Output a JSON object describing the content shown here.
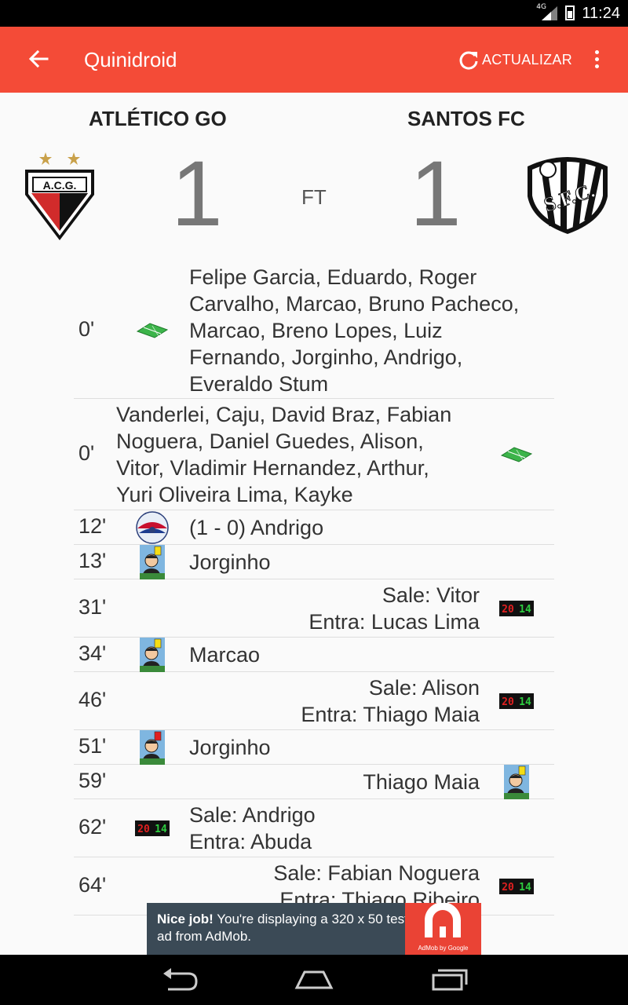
{
  "status_bar": {
    "time": "11:24",
    "network": "4G"
  },
  "app_bar": {
    "title": "Quinidroid",
    "refresh_label": "ACTUALIZAR"
  },
  "match": {
    "home": {
      "name": "ATLÉTICO GO",
      "score": "1",
      "crest_text": "A.C.G."
    },
    "away": {
      "name": "SANTOS FC",
      "score": "1",
      "crest_text": "S.F.C."
    },
    "status": "FT"
  },
  "events": [
    {
      "minute": "0'",
      "side": "home",
      "type": "lineup",
      "lines": [
        "Felipe Garcia, Eduardo, Roger",
        "Carvalho, Marcao, Bruno Pacheco,",
        "Marcao, Breno Lopes, Luiz",
        "Fernando, Jorginho, Andrigo,",
        "Everaldo Stum"
      ]
    },
    {
      "minute": "0'",
      "side": "away",
      "type": "lineup",
      "lines": [
        "Vanderlei, Caju, David Braz, Fabian",
        "Noguera, Daniel Guedes, Alison,",
        "Vitor, Vladimir Hernandez, Arthur,",
        "Yuri Oliveira Lima, Kayke"
      ]
    },
    {
      "minute": "12'",
      "side": "home",
      "type": "goal",
      "lines": [
        "(1 - 0) Andrigo"
      ]
    },
    {
      "minute": "13'",
      "side": "home",
      "type": "yellow-card",
      "lines": [
        "Jorginho"
      ]
    },
    {
      "minute": "31'",
      "side": "away",
      "type": "substitution",
      "lines": [
        "Sale: Vitor",
        "Entra: Lucas Lima"
      ]
    },
    {
      "minute": "34'",
      "side": "home",
      "type": "yellow-card",
      "lines": [
        "Marcao"
      ]
    },
    {
      "minute": "46'",
      "side": "away",
      "type": "substitution",
      "lines": [
        "Sale: Alison",
        "Entra: Thiago Maia"
      ]
    },
    {
      "minute": "51'",
      "side": "home",
      "type": "red-card",
      "lines": [
        "Jorginho"
      ]
    },
    {
      "minute": "59'",
      "side": "away",
      "type": "yellow-card",
      "lines": [
        "Thiago Maia"
      ]
    },
    {
      "minute": "62'",
      "side": "home",
      "type": "substitution",
      "lines": [
        "Sale: Andrigo",
        "Entra: Abuda"
      ]
    },
    {
      "minute": "64'",
      "side": "away",
      "type": "substitution",
      "lines": [
        "Sale: Fabian Noguera",
        "Entra: Thiago Ribeiro"
      ]
    }
  ],
  "ad": {
    "bold": "Nice job!",
    "text": " You're displaying a 320 x 50 test ad from AdMob.",
    "brand": "AdMob by Google"
  },
  "colors": {
    "app_bar": "#f44b37",
    "background": "#fafafa",
    "ad_bg": "#3b4a56"
  }
}
